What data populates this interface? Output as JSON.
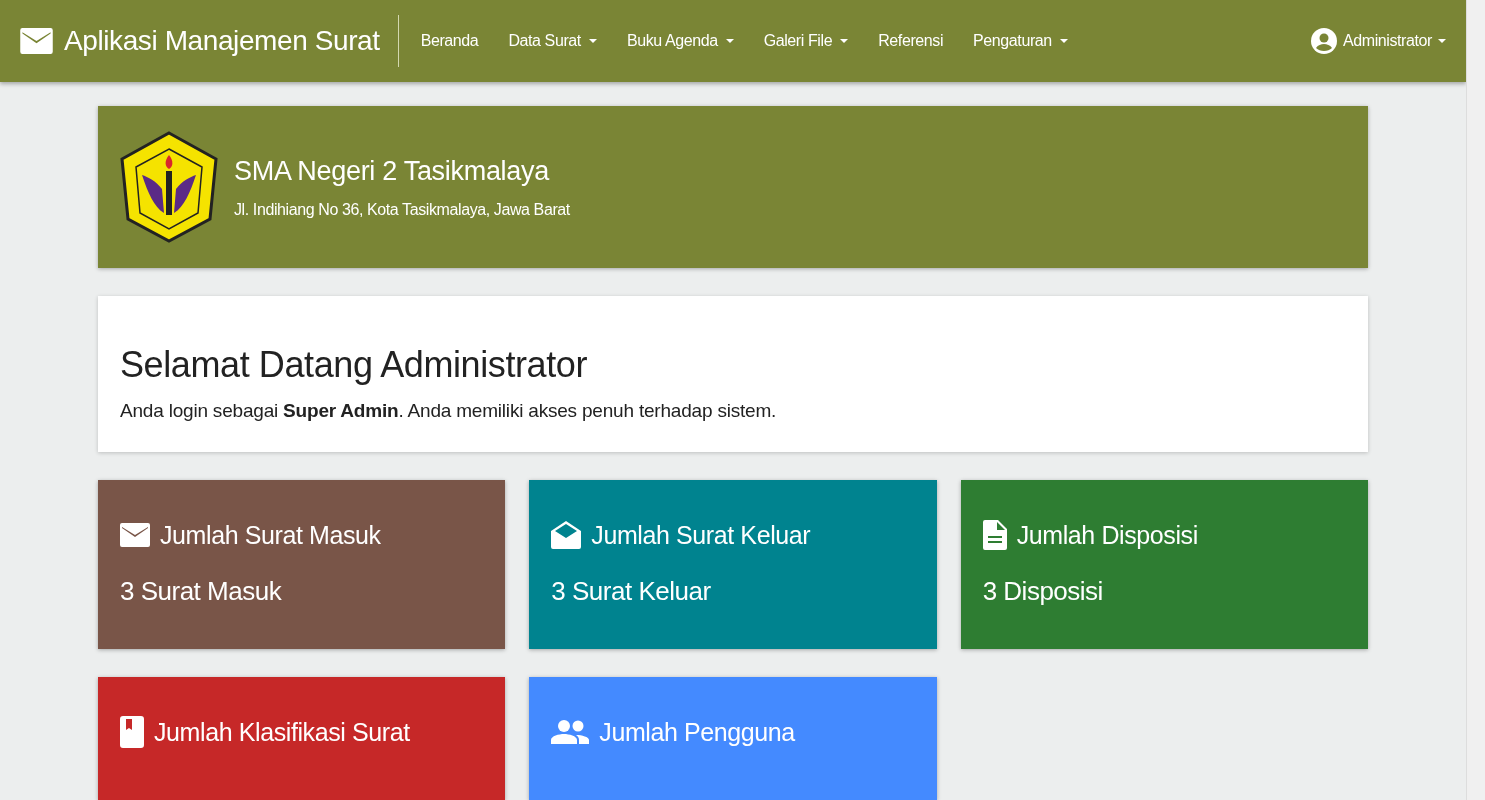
{
  "navbar": {
    "brand": "Aplikasi Manajemen Surat",
    "menu": [
      {
        "label": "Beranda",
        "dropdown": false
      },
      {
        "label": "Data Surat",
        "dropdown": true
      },
      {
        "label": "Buku Agenda",
        "dropdown": true
      },
      {
        "label": "Galeri File",
        "dropdown": true
      },
      {
        "label": "Referensi",
        "dropdown": false
      },
      {
        "label": "Pengaturan",
        "dropdown": true
      }
    ],
    "user": {
      "label": "Administrator",
      "dropdown": true
    }
  },
  "school": {
    "name": "SMA Negeri 2 Tasikmalaya",
    "address": "Jl. Indihiang No 36, Kota Tasikmalaya, Jawa Barat"
  },
  "welcome": {
    "title": "Selamat Datang Administrator",
    "text": "Anda login sebagai **Super Admin**. Anda memiliki akses penuh terhadap sistem."
  },
  "stats": [
    {
      "kind": "mail",
      "title": "Jumlah Surat Masuk",
      "value": "3 Surat Masuk",
      "color": "#795548"
    },
    {
      "kind": "open-mail",
      "title": "Jumlah Surat Keluar",
      "value": "3 Surat Keluar",
      "color": "#00838f"
    },
    {
      "kind": "document",
      "title": "Jumlah Disposisi",
      "value": "3 Disposisi",
      "color": "#2e7d32"
    },
    {
      "kind": "book",
      "title": "Jumlah Klasifikasi Surat",
      "color": "#c62828"
    },
    {
      "kind": "people",
      "title": "Jumlah Pengguna",
      "color": "#448aff"
    }
  ]
}
